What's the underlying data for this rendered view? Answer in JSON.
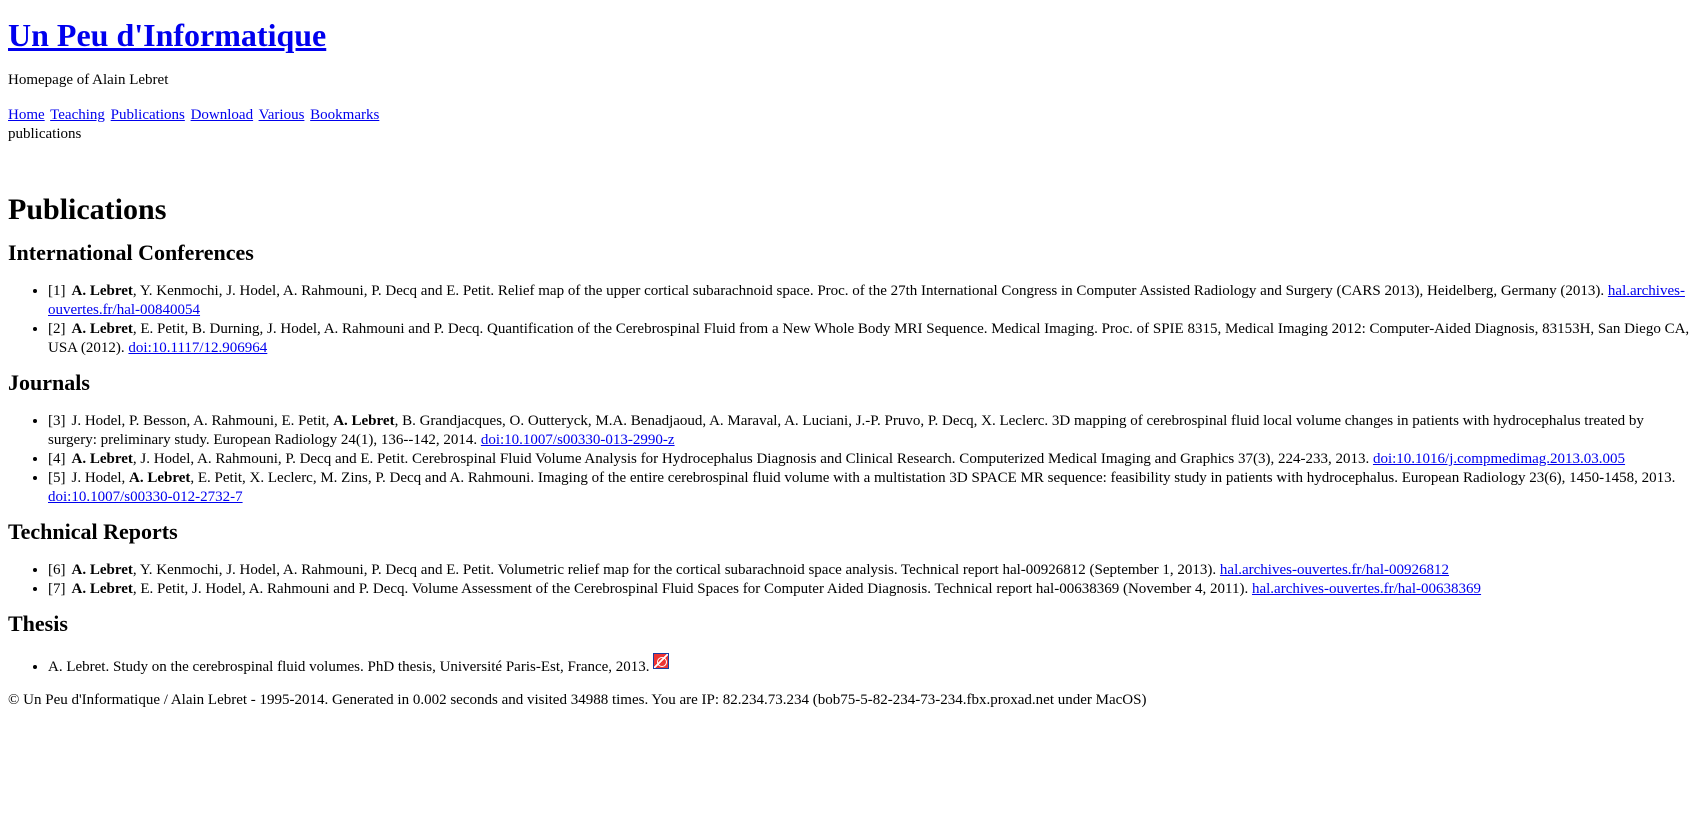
{
  "header": {
    "site_title": "Un Peu d'Informatique",
    "tagline": "Homepage of Alain Lebret"
  },
  "nav": {
    "items": [
      "Home",
      "Teaching",
      "Publications",
      "Download",
      "Various",
      "Bookmarks"
    ],
    "breadcrumb": "publications"
  },
  "main": {
    "title": "Publications",
    "sections": {
      "conferences": {
        "heading": "International Conferences",
        "items": [
          {
            "num": "[1]",
            "author": "A. Lebret",
            "text": ", Y. Kenmochi, J. Hodel, A. Rahmouni, P. Decq and E. Petit. Relief map of the upper cortical subarachnoid space. Proc. of the 27th International Congress in Computer Assisted Radiology and Surgery (CARS 2013), Heidelberg, Germany (2013). ",
            "link": "hal.archives-ouvertes.fr/hal-00840054"
          },
          {
            "num": "[2]",
            "author": "A. Lebret",
            "text": ", E. Petit, B. Durning, J. Hodel, A. Rahmouni and P. Decq. Quantification of the Cerebrospinal Fluid from a New Whole Body MRI Sequence. Medical Imaging. Proc. of SPIE 8315, Medical Imaging 2012: Computer-Aided Diagnosis, 83153H, San Diego CA, USA (2012). ",
            "link": "doi:10.1117/12.906964"
          }
        ]
      },
      "journals": {
        "heading": "Journals",
        "items": [
          {
            "num": "[3]",
            "pre": "J. Hodel, P. Besson, A. Rahmouni, E. Petit, ",
            "author": "A. Lebret",
            "text": ", B. Grandjacques, O. Outteryck, M.A. Benadjaoud, A. Maraval, A. Luciani, J.-P. Pruvo, P. Decq, X. Leclerc. 3D mapping of cerebrospinal fluid local volume changes in patients with hydrocephalus treated by surgery: preliminary study. European Radiology 24(1), 136--142, 2014. ",
            "link": "doi:10.1007/s00330-013-2990-z"
          },
          {
            "num": "[4]",
            "pre": "",
            "author": "A. Lebret",
            "text": ", J. Hodel, A. Rahmouni, P. Decq and E. Petit. Cerebrospinal Fluid Volume Analysis for Hydrocephalus Diagnosis and Clinical Research. Computerized Medical Imaging and Graphics 37(3), 224-233, 2013. ",
            "link": "doi:10.1016/j.compmedimag.2013.03.005"
          },
          {
            "num": "[5]",
            "pre": "J. Hodel, ",
            "author": "A. Lebret",
            "text": ", E. Petit, X. Leclerc, M. Zins, P. Decq and A. Rahmouni. Imaging of the entire cerebrospinal fluid volume with a multistation 3D SPACE MR sequence: feasibility study in patients with hydrocephalus. European Radiology 23(6), 1450-1458, 2013. ",
            "link": "doi:10.1007/s00330-012-2732-7"
          }
        ]
      },
      "reports": {
        "heading": "Technical Reports",
        "items": [
          {
            "num": "[6]",
            "author": "A. Lebret",
            "text": ", Y. Kenmochi, J. Hodel, A. Rahmouni, P. Decq and E. Petit. Volumetric relief map for the cortical subarachnoid space analysis. Technical report hal-00926812 (September 1, 2013). ",
            "link": "hal.archives-ouvertes.fr/hal-00926812"
          },
          {
            "num": "[7]",
            "author": "A. Lebret",
            "text": ", E. Petit, J. Hodel, A. Rahmouni and P. Decq. Volume Assessment of the Cerebrospinal Fluid Spaces for Computer Aided Diagnosis. Technical report hal-00638369 (November 4, 2011). ",
            "link": "hal.archives-ouvertes.fr/hal-00638369"
          }
        ]
      },
      "thesis": {
        "heading": "Thesis",
        "item": "A. Lebret. Study on the cerebrospinal fluid volumes. PhD thesis, Université Paris-Est, France, 2013. ",
        "icon": "pdf-icon"
      }
    }
  },
  "footer": {
    "text": "© Un Peu d'Informatique / Alain Lebret - 1995-2014. Generated in 0.002 seconds and visited 34988 times. You are IP: 82.234.73.234 (bob75-5-82-234-73-234.fbx.proxad.net under MacOS)"
  },
  "colors": {
    "link": "#0000ee",
    "text": "#000000",
    "background": "#ffffff"
  }
}
